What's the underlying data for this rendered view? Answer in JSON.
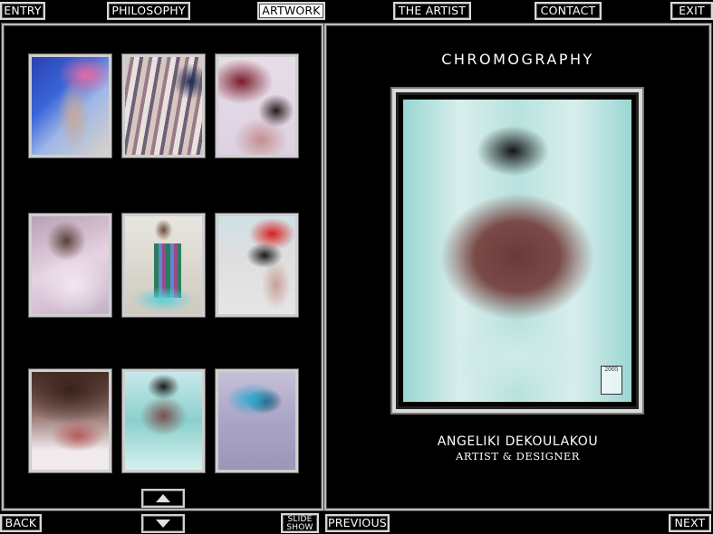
{
  "nav": {
    "entry": "ENTRY",
    "philosophy": "PHILOSOPHY",
    "artwork": "ARTWORK",
    "the_artist": "THE ARTIST",
    "contact": "CONTACT",
    "exit": "EXIT"
  },
  "bottom": {
    "back": "BACK",
    "slide_show_line1": "SLIDE",
    "slide_show_line2": "SHOW",
    "previous": "PREVIOUS",
    "next": "NEXT"
  },
  "gallery": {
    "title": "CHROMOGRAPHY",
    "thumbnails": [
      {
        "name": "thumbnail-1"
      },
      {
        "name": "thumbnail-2"
      },
      {
        "name": "thumbnail-3"
      },
      {
        "name": "thumbnail-4"
      },
      {
        "name": "thumbnail-5"
      },
      {
        "name": "thumbnail-6"
      },
      {
        "name": "thumbnail-7"
      },
      {
        "name": "thumbnail-8"
      },
      {
        "name": "thumbnail-9"
      }
    ],
    "stamp_year": "2005"
  },
  "artist": {
    "name": "ANGELIKI DEKOULAKOU",
    "role": "ARTIST & DESIGNER"
  },
  "colors": {
    "background": "#000000",
    "frame": "#d9d9d9",
    "active_nav_bg": "#ffffff"
  },
  "icons": [
    "arrow-up-icon",
    "arrow-down-icon"
  ]
}
